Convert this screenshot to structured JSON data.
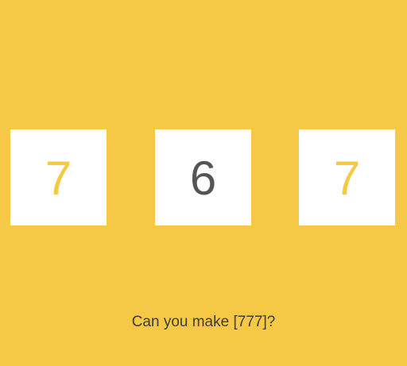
{
  "tiles": [
    {
      "digit": "7",
      "color": "#f5c945"
    },
    {
      "digit": "6",
      "color": "#555555"
    },
    {
      "digit": "7",
      "color": "#f5c945"
    }
  ],
  "prompt": "Can you make [777]?",
  "colors": {
    "background": "#f5c945",
    "tile": "#ffffff",
    "text": "#3d3d3d"
  }
}
